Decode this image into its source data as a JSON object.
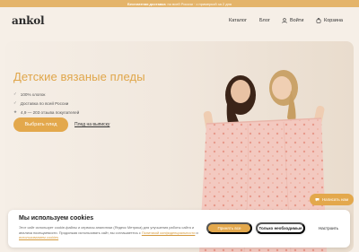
{
  "promo": {
    "strong": "Бесплатная доставка",
    "text": "по всей России · с примеркой за 2 дня"
  },
  "header": {
    "logo": "ankol",
    "nav": {
      "catalog": "Каталог",
      "blog": "Блог",
      "login": "Войти",
      "cart": "Корзина"
    }
  },
  "hero": {
    "title": "Детские вязаные пледы",
    "features": [
      "100% хлопок",
      "Доставка по всей России",
      "4,9 — 203 отзыва покупателей"
    ],
    "feature_icons": [
      "check-icon",
      "check-icon",
      "star-icon"
    ],
    "primary_button": "Выбрать плед",
    "installment_link": "Плед на выписку"
  },
  "chat": {
    "label": "Написать нам"
  },
  "cookie": {
    "title": "Мы используем cookies",
    "text": "Этот сайт использует cookie-файлы и сервисы аналитики (Яндекс Метрика) для улучшения работы сайта и анализа посещаемости. Продолжая использовать сайт, вы соглашаетесь с",
    "link1": "Политикой конфиденциальности",
    "and": "и",
    "link2": "использованием cookies",
    "accept": "Принять все",
    "necessary": "Только необходимые",
    "configure": "Настроить"
  },
  "colors": {
    "accent": "#e3a84c",
    "title": "#e0a64a",
    "background": "#f6efe7"
  }
}
